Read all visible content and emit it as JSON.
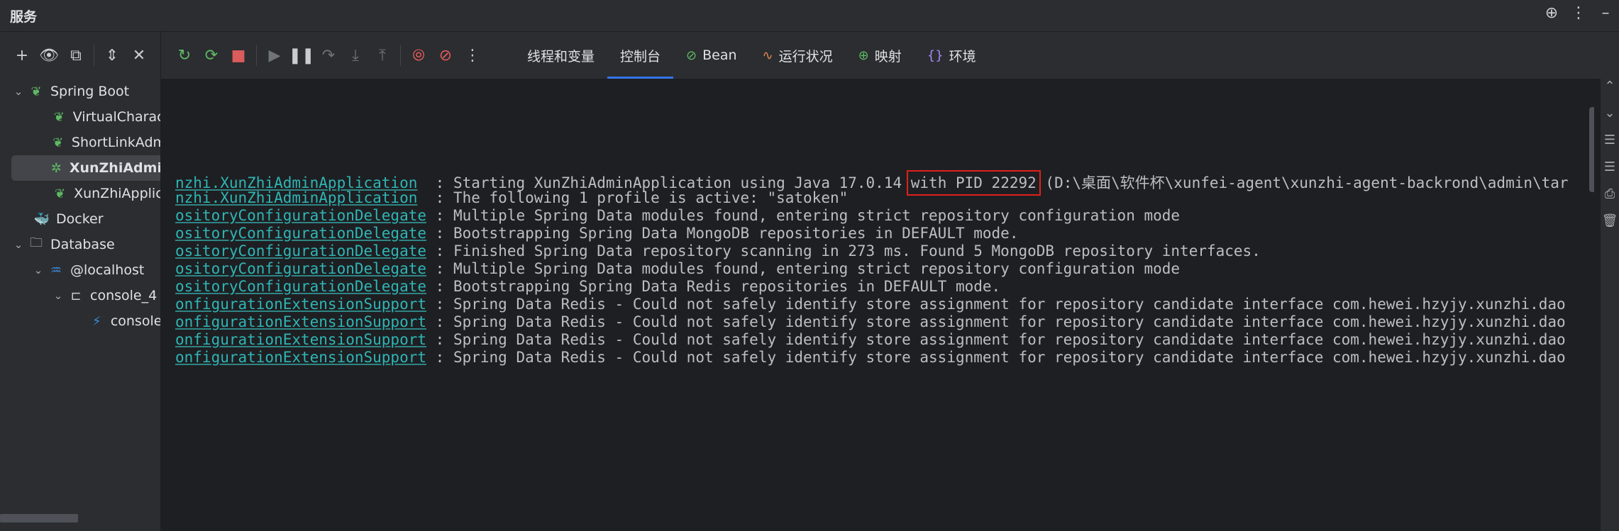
{
  "window": {
    "title": "服务"
  },
  "title_icons": [
    "target-icon",
    "more-icon",
    "minimize-icon"
  ],
  "left_toolbar": [
    "add-icon",
    "eye-icon",
    "new-tab-icon",
    "expand-icon",
    "collapse-icon"
  ],
  "tree": [
    {
      "label": "Spring Boot",
      "level": 0,
      "expanded": true,
      "icon": "spring-boot-icon"
    },
    {
      "label": "VirtualCharac",
      "level": 1,
      "icon": "spring-app-error-icon"
    },
    {
      "label": "ShortLinkAdm",
      "level": 1,
      "icon": "spring-app-icon"
    },
    {
      "label": "XunZhiAdmin",
      "level": 1,
      "icon": "spring-app-debug-icon",
      "selected": true
    },
    {
      "label": "XunZhiApplic",
      "level": 1,
      "icon": "spring-app-error-icon"
    },
    {
      "label": "Docker",
      "level": 0,
      "icon": "docker-icon"
    },
    {
      "label": "Database",
      "level": 0,
      "expanded": true,
      "icon": "folder-icon"
    },
    {
      "label": "@localhost",
      "level": 1,
      "expanded": true,
      "icon": "mysql-icon"
    },
    {
      "label": "console_4",
      "level": 2,
      "expanded": true,
      "icon": "console-icon"
    },
    {
      "label": "console",
      "level": 3,
      "icon": "sql-console-icon"
    }
  ],
  "run_toolbar": [
    "rerun-icon",
    "rerun-debug-icon",
    "stop-icon",
    "resume-icon",
    "pause-icon",
    "step-over-icon",
    "step-into-icon",
    "step-out-icon",
    "breakpoints-icon",
    "mute-breakpoints-icon",
    "more-icon"
  ],
  "tabs": [
    {
      "label": "线程和变量",
      "icon": ""
    },
    {
      "label": "控制台",
      "icon": "",
      "active": true
    },
    {
      "label": "Bean",
      "icon": "bean-icon"
    },
    {
      "label": "运行状况",
      "icon": "health-icon"
    },
    {
      "label": "映射",
      "icon": "mapping-icon"
    },
    {
      "label": "环境",
      "icon": "environment-icon"
    }
  ],
  "console": {
    "lines": [
      {
        "logger_prefix": "nzhi.",
        "logger": "XunZhiAdminApplication",
        "pad": "  ",
        "msg_pre": ": Starting XunZhiAdminApplication using Java 17.0.14 ",
        "highlight": "with PID 22292",
        "msg_post": " (D:\\桌面\\软件杯\\xunfei-agent\\xunzhi-agent-backrond\\admin\\tar"
      },
      {
        "logger_prefix": "nzhi.",
        "logger": "XunZhiAdminApplication",
        "pad": "  ",
        "msg_pre": ": The following 1 profile is active: \"satoken\"",
        "highlight": "",
        "msg_post": ""
      },
      {
        "logger_prefix": "",
        "logger": "ositoryConfigurationDelegate",
        "pad": " ",
        "msg_pre": ": Multiple Spring Data modules found, entering strict repository configuration mode",
        "highlight": "",
        "msg_post": ""
      },
      {
        "logger_prefix": "",
        "logger": "ositoryConfigurationDelegate",
        "pad": " ",
        "msg_pre": ": Bootstrapping Spring Data MongoDB repositories in DEFAULT mode.",
        "highlight": "",
        "msg_post": ""
      },
      {
        "logger_prefix": "",
        "logger": "ositoryConfigurationDelegate",
        "pad": " ",
        "msg_pre": ": Finished Spring Data repository scanning in 273 ms. Found 5 MongoDB repository interfaces.",
        "highlight": "",
        "msg_post": ""
      },
      {
        "logger_prefix": "",
        "logger": "ositoryConfigurationDelegate",
        "pad": " ",
        "msg_pre": ": Multiple Spring Data modules found, entering strict repository configuration mode",
        "highlight": "",
        "msg_post": ""
      },
      {
        "logger_prefix": "",
        "logger": "ositoryConfigurationDelegate",
        "pad": " ",
        "msg_pre": ": Bootstrapping Spring Data Redis repositories in DEFAULT mode.",
        "highlight": "",
        "msg_post": ""
      },
      {
        "logger_prefix": "",
        "logger": "onfigurationExtensionSupport",
        "pad": " ",
        "msg_pre": ": Spring Data Redis - Could not safely identify store assignment for repository candidate interface com.hewei.hzyjy.xunzhi.dao",
        "highlight": "",
        "msg_post": ""
      },
      {
        "logger_prefix": "",
        "logger": "onfigurationExtensionSupport",
        "pad": " ",
        "msg_pre": ": Spring Data Redis - Could not safely identify store assignment for repository candidate interface com.hewei.hzyjy.xunzhi.dao",
        "highlight": "",
        "msg_post": ""
      },
      {
        "logger_prefix": "",
        "logger": "onfigurationExtensionSupport",
        "pad": " ",
        "msg_pre": ": Spring Data Redis - Could not safely identify store assignment for repository candidate interface com.hewei.hzyjy.xunzhi.dao",
        "highlight": "",
        "msg_post": ""
      },
      {
        "logger_prefix": "",
        "logger": "onfigurationExtensionSupport",
        "pad": " ",
        "msg_pre": ": Spring Data Redis - Could not safely identify store assignment for repository candidate interface com.hewei.hzyjy.xunzhi.dao",
        "highlight": "",
        "msg_post": ""
      }
    ]
  },
  "right_strip": [
    "scroll-up-icon",
    "scroll-down-icon",
    "soft-wrap-icon",
    "scroll-end-icon",
    "print-icon",
    "trash-icon"
  ],
  "colors": {
    "accent": "#3574f0",
    "logger": "#2fb5b5",
    "highlight_box": "#e0201c",
    "background": "#1e1f22",
    "panel": "#2b2d30"
  }
}
